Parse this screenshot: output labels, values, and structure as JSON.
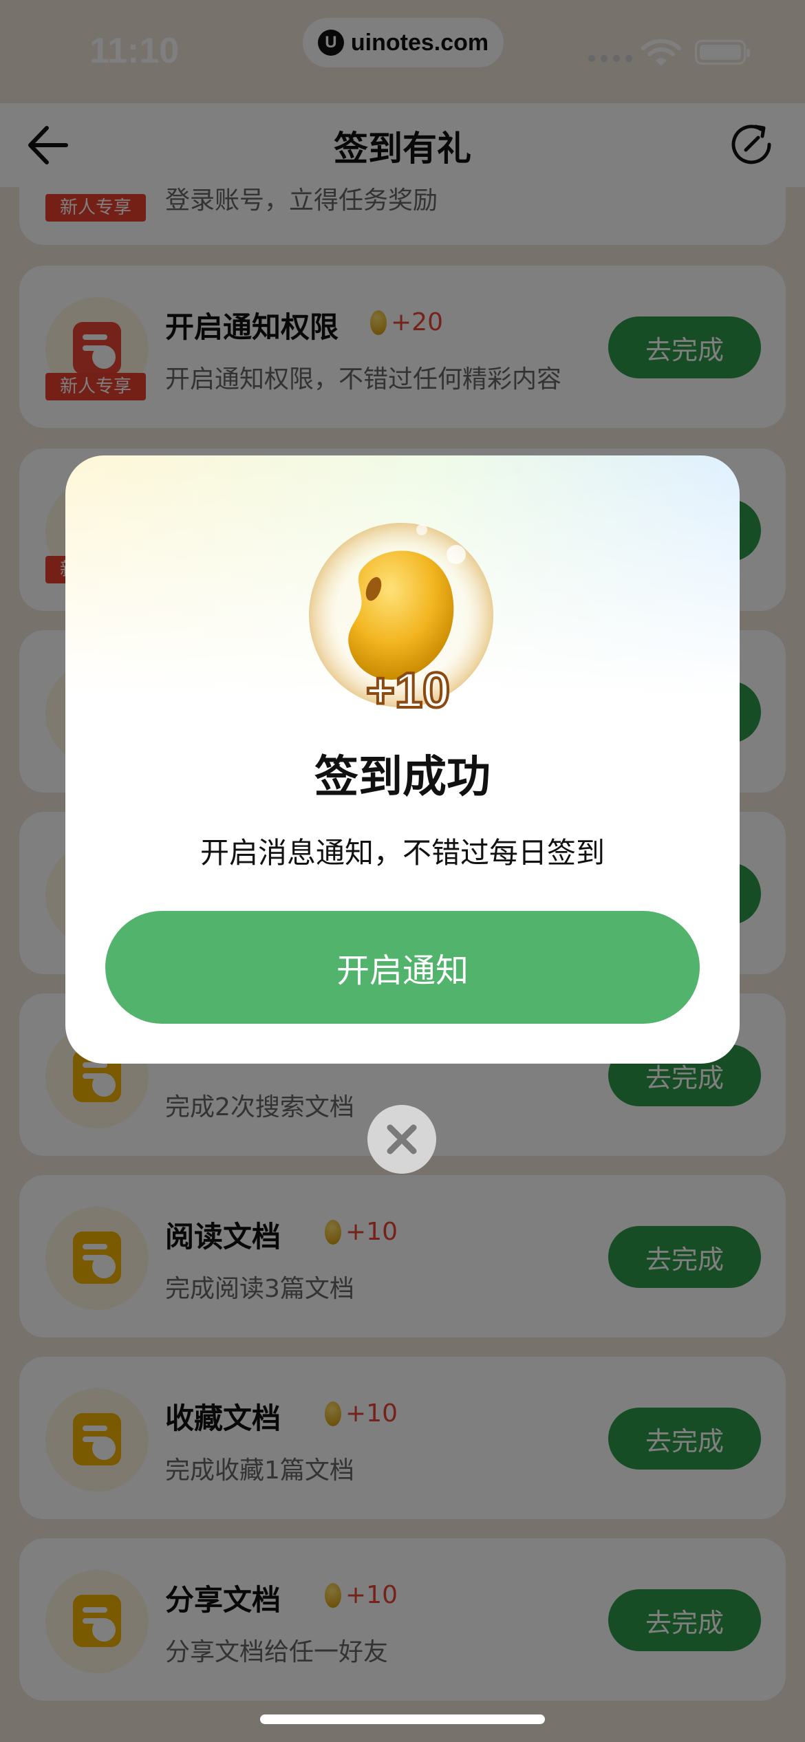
{
  "status_bar": {
    "time": "11:10",
    "watermark": "uinotes.com",
    "watermark_logo": "U"
  },
  "navbar": {
    "title": "签到有礼"
  },
  "tasks": [
    {
      "title": "",
      "reward": "",
      "desc": "登录账号，立得任务奖励",
      "button": "",
      "tag": "新人专享"
    },
    {
      "title": "开启通知权限",
      "reward": "+20",
      "desc": "开启通知权限，不错过任何精彩内容",
      "button": "去完成",
      "tag": "新人专享"
    },
    {
      "title": "",
      "reward": "",
      "desc": "",
      "button": "",
      "tag": "新人专享"
    },
    {
      "title": "",
      "reward": "",
      "desc": "",
      "button": ""
    },
    {
      "title": "",
      "reward": "",
      "desc": "",
      "button": ""
    },
    {
      "title": "",
      "reward": "",
      "desc": "完成2次搜索文档",
      "button": "去完成"
    },
    {
      "title": "阅读文档",
      "reward": "+10",
      "desc": "完成阅读3篇文档",
      "button": "去完成"
    },
    {
      "title": "收藏文档",
      "reward": "+10",
      "desc": "完成收藏1篇文档",
      "button": "去完成"
    },
    {
      "title": "分享文档",
      "reward": "+10",
      "desc": "分享文档给任一好友",
      "button": "去完成"
    }
  ],
  "modal": {
    "coin_amount": "+10",
    "title": "签到成功",
    "message": "开启消息通知，不错过每日签到",
    "button": "开启通知"
  },
  "colors": {
    "accent": "#52b36c",
    "task_button": "#2f9a48",
    "reward": "#ea4634"
  }
}
